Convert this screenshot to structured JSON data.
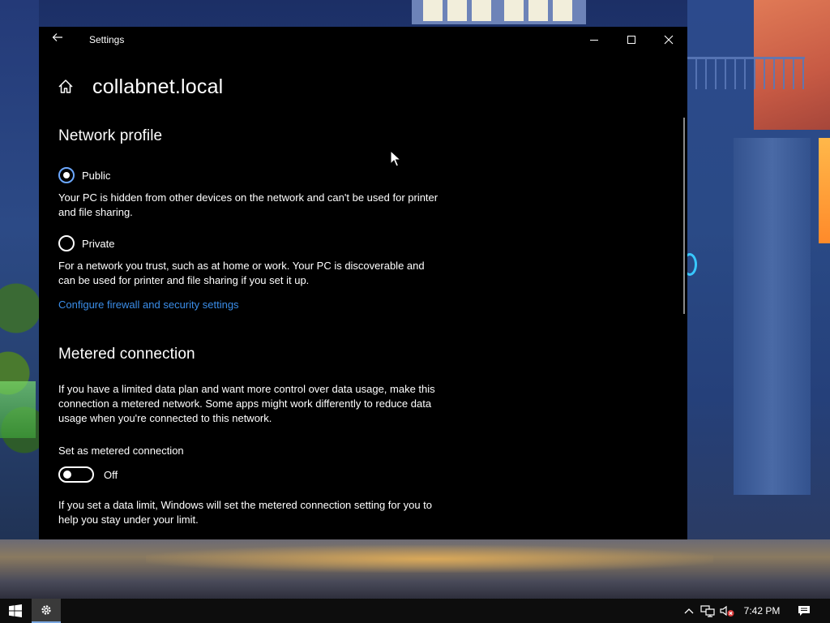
{
  "window": {
    "title": "Settings",
    "back_label": "←"
  },
  "page": {
    "title": "collabnet.local"
  },
  "network_profile": {
    "heading": "Network profile",
    "options": [
      {
        "label": "Public",
        "selected": true,
        "description": "Your PC is hidden from other devices on the network and can't be used for printer and file sharing."
      },
      {
        "label": "Private",
        "selected": false,
        "description": "For a network you trust, such as at home or work. Your PC is discoverable and can be used for printer and file sharing if you set it up."
      }
    ],
    "firewall_link": "Configure firewall and security settings"
  },
  "metered": {
    "heading": "Metered connection",
    "description": "If you have a limited data plan and want more control over data usage, make this connection a metered network. Some apps might work differently to reduce data usage when you're connected to this network.",
    "toggle_label": "Set as metered connection",
    "toggle_state": "Off",
    "data_limit_text": "If you set a data limit, Windows will set the metered connection setting for you to help you stay under your limit."
  },
  "taskbar": {
    "clock": "7:42 PM",
    "pinned": [
      "start-icon",
      "settings-gear-icon"
    ],
    "tray_icons": [
      "chevron-up-icon",
      "network-icon",
      "volume-muted-icon",
      "notification-icon"
    ]
  },
  "colors": {
    "accent_link": "#3b8eea",
    "radio_selected_ring": "#6ca8ff",
    "window_bg": "#000000"
  }
}
